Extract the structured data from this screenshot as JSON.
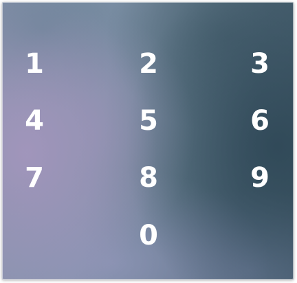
{
  "keypad": {
    "keys": [
      "1",
      "2",
      "3",
      "4",
      "5",
      "6",
      "7",
      "8",
      "9",
      "0"
    ]
  }
}
